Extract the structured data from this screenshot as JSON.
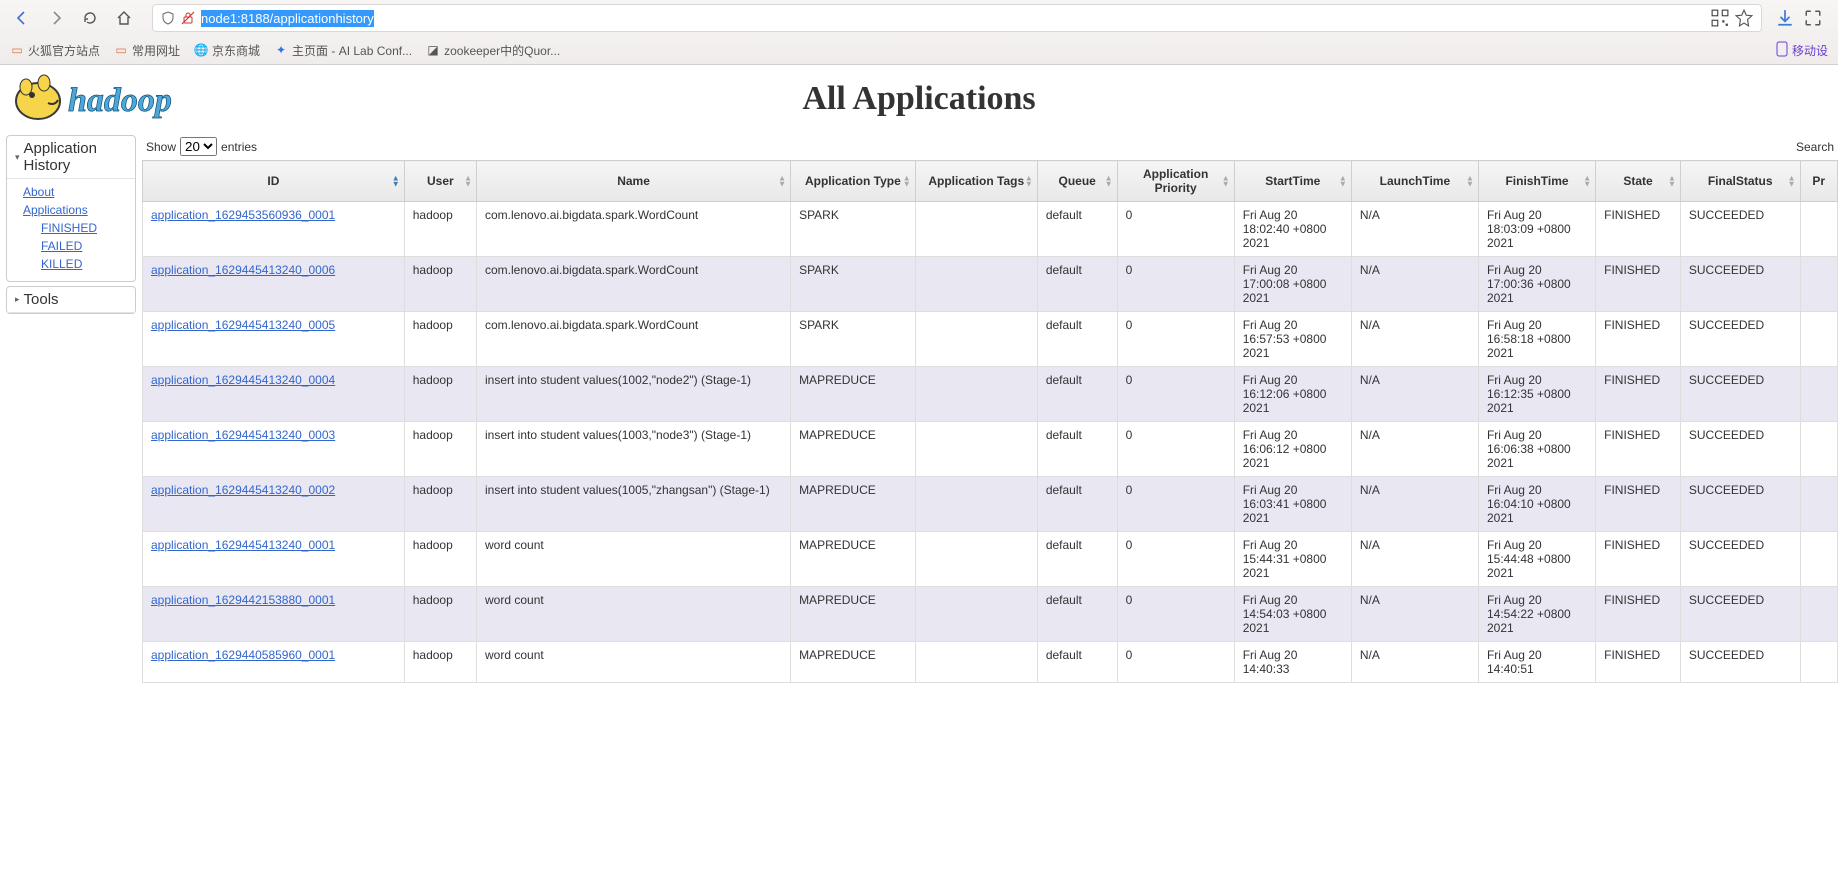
{
  "browser": {
    "url_visible": "node1:8188/applicationhistory",
    "bookmarks": [
      {
        "icon": "folder",
        "label": "火狐官方站点",
        "color": "#d97742"
      },
      {
        "icon": "folder",
        "label": "常用网址",
        "color": "#d97742"
      },
      {
        "icon": "globe",
        "label": "京东商城",
        "color": "#6b6b6b"
      },
      {
        "icon": "site",
        "label": "主页面 - AI Lab Conf...",
        "color": "#2c7be5"
      },
      {
        "icon": "site",
        "label": "zookeeper中的Quor...",
        "color": "#444"
      }
    ],
    "mobile_label": "移动设"
  },
  "page_title": "All Applications",
  "sidebar": {
    "apphistory_title": "Application History",
    "about": "About",
    "applications": "Applications",
    "finished": "FINISHED",
    "failed": "FAILED",
    "killed": "KILLED",
    "tools_title": "Tools"
  },
  "table": {
    "show_label": "Show",
    "entries_label": "entries",
    "entries_value": "20",
    "search_label": "Search",
    "columns": [
      "ID",
      "User",
      "Name",
      "Application Type",
      "Application Tags",
      "Queue",
      "Application Priority",
      "StartTime",
      "LaunchTime",
      "FinishTime",
      "State",
      "FinalStatus",
      "Pr"
    ],
    "rows": [
      {
        "id": "application_1629453560936_0001",
        "user": "hadoop",
        "name": "com.lenovo.ai.bigdata.spark.WordCount",
        "apptype": "SPARK",
        "tags": "",
        "queue": "default",
        "priority": "0",
        "start": "Fri Aug 20 18:02:40 +0800 2021",
        "launch": "N/A",
        "finish": "Fri Aug 20 18:03:09 +0800 2021",
        "state": "FINISHED",
        "final": "SUCCEEDED"
      },
      {
        "id": "application_1629445413240_0006",
        "user": "hadoop",
        "name": "com.lenovo.ai.bigdata.spark.WordCount",
        "apptype": "SPARK",
        "tags": "",
        "queue": "default",
        "priority": "0",
        "start": "Fri Aug 20 17:00:08 +0800 2021",
        "launch": "N/A",
        "finish": "Fri Aug 20 17:00:36 +0800 2021",
        "state": "FINISHED",
        "final": "SUCCEEDED"
      },
      {
        "id": "application_1629445413240_0005",
        "user": "hadoop",
        "name": "com.lenovo.ai.bigdata.spark.WordCount",
        "apptype": "SPARK",
        "tags": "",
        "queue": "default",
        "priority": "0",
        "start": "Fri Aug 20 16:57:53 +0800 2021",
        "launch": "N/A",
        "finish": "Fri Aug 20 16:58:18 +0800 2021",
        "state": "FINISHED",
        "final": "SUCCEEDED"
      },
      {
        "id": "application_1629445413240_0004",
        "user": "hadoop",
        "name": "insert into student values(1002,\"node2\") (Stage-1)",
        "apptype": "MAPREDUCE",
        "tags": "",
        "queue": "default",
        "priority": "0",
        "start": "Fri Aug 20 16:12:06 +0800 2021",
        "launch": "N/A",
        "finish": "Fri Aug 20 16:12:35 +0800 2021",
        "state": "FINISHED",
        "final": "SUCCEEDED"
      },
      {
        "id": "application_1629445413240_0003",
        "user": "hadoop",
        "name": "insert into student values(1003,\"node3\") (Stage-1)",
        "apptype": "MAPREDUCE",
        "tags": "",
        "queue": "default",
        "priority": "0",
        "start": "Fri Aug 20 16:06:12 +0800 2021",
        "launch": "N/A",
        "finish": "Fri Aug 20 16:06:38 +0800 2021",
        "state": "FINISHED",
        "final": "SUCCEEDED"
      },
      {
        "id": "application_1629445413240_0002",
        "user": "hadoop",
        "name": "insert into student values(1005,\"zhangsan\") (Stage-1)",
        "apptype": "MAPREDUCE",
        "tags": "",
        "queue": "default",
        "priority": "0",
        "start": "Fri Aug 20 16:03:41 +0800 2021",
        "launch": "N/A",
        "finish": "Fri Aug 20 16:04:10 +0800 2021",
        "state": "FINISHED",
        "final": "SUCCEEDED"
      },
      {
        "id": "application_1629445413240_0001",
        "user": "hadoop",
        "name": "word count",
        "apptype": "MAPREDUCE",
        "tags": "",
        "queue": "default",
        "priority": "0",
        "start": "Fri Aug 20 15:44:31 +0800 2021",
        "launch": "N/A",
        "finish": "Fri Aug 20 15:44:48 +0800 2021",
        "state": "FINISHED",
        "final": "SUCCEEDED"
      },
      {
        "id": "application_1629442153880_0001",
        "user": "hadoop",
        "name": "word count",
        "apptype": "MAPREDUCE",
        "tags": "",
        "queue": "default",
        "priority": "0",
        "start": "Fri Aug 20 14:54:03 +0800 2021",
        "launch": "N/A",
        "finish": "Fri Aug 20 14:54:22 +0800 2021",
        "state": "FINISHED",
        "final": "SUCCEEDED"
      },
      {
        "id": "application_1629440585960_0001",
        "user": "hadoop",
        "name": "word count",
        "apptype": "MAPREDUCE",
        "tags": "",
        "queue": "default",
        "priority": "0",
        "start": "Fri Aug 20 14:40:33",
        "launch": "N/A",
        "finish": "Fri Aug 20 14:40:51",
        "state": "FINISHED",
        "final": "SUCCEEDED"
      }
    ]
  }
}
